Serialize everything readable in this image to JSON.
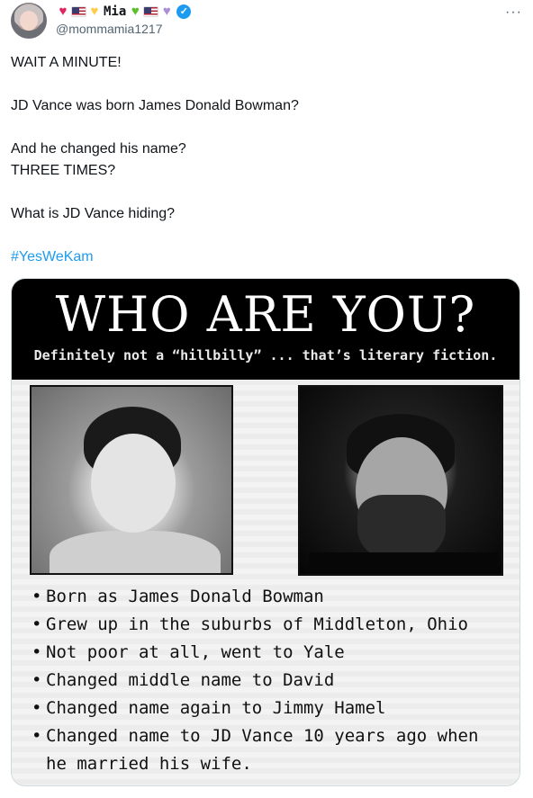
{
  "tweet": {
    "display_name_text": "Mia",
    "display_name_emojis": [
      "red-heart",
      "us-flag",
      "yellow-heart",
      "green-heart",
      "us-flag",
      "purple-heart"
    ],
    "handle": "@mommamia1217",
    "more_label": "···",
    "body_lines": [
      "WAIT A MINUTE!",
      "",
      "JD Vance was born James Donald Bowman?",
      "",
      "And he changed his name?",
      "THREE TIMES?",
      "",
      "What is JD Vance hiding?",
      ""
    ],
    "hashtag": "#YesWeKam",
    "colors": {
      "hashtag": "#1d9bf0",
      "verified": "#1d9bf0",
      "handle": "#536471"
    }
  },
  "media": {
    "title": "WHO ARE YOU?",
    "subtitle": "Definitely not a “hillbilly” ... that’s literary fiction.",
    "facts": [
      "Born as James Donald Bowman",
      "Grew up in the suburbs of Middleton, Ohio",
      "Not poor at all, went to Yale",
      "Changed middle name to David",
      "Changed name again to Jimmy Hamel",
      "Changed name to JD Vance 10 years ago when he married his wife."
    ]
  },
  "icons": {
    "avatar": "avatar",
    "verified": "verified-badge-icon",
    "more": "more-options-icon"
  }
}
